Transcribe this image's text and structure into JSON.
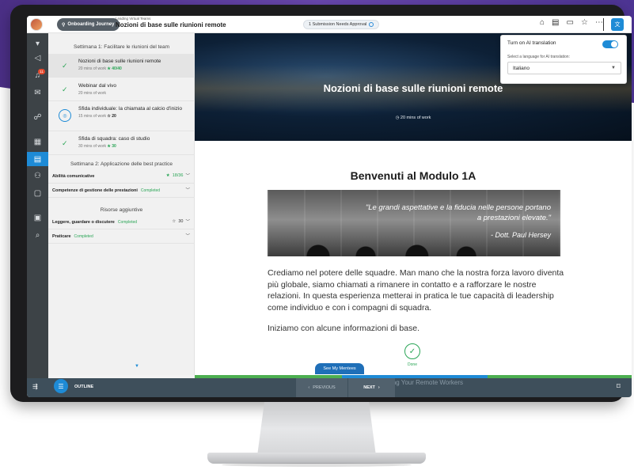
{
  "topbar": {
    "course_pill": "Onboarding Journey",
    "crumb_small": "Leading Virtual Teams",
    "crumb_title": "Nozioni di base sulle riunioni remote",
    "approval": "1 Submission Needs Approval"
  },
  "popup": {
    "title": "Turn on AI translation",
    "label": "Select a language for AI translation:",
    "selected": "Italiano",
    "enabled": true
  },
  "outline": {
    "section1": "Settimana 1: Facilitare le riunioni del team",
    "lessons": [
      {
        "title": "Nozioni di base sulle riunioni remote",
        "meta": "20 mins of work",
        "pts": "40/40",
        "status": "done"
      },
      {
        "title": "Webinar dal vivo",
        "meta": "20 mins of work",
        "pts": "",
        "status": "done"
      },
      {
        "title": "Sfida individuale: la chiamata al calcio d'inizio",
        "meta": "15 mins of work",
        "pts": "20",
        "status": "pending"
      },
      {
        "title": "Sfida di squadra: caso di studio",
        "meta": "30 mins of work",
        "pts": "30",
        "status": "done"
      }
    ],
    "section2": "Settimana 2: Applicazione delle best practice",
    "group1": {
      "title": "Abilità comunicative",
      "score": "18/36"
    },
    "group2": {
      "title": "Competenze di gestione delle prestazioni",
      "status": "Completed"
    },
    "section3": "Risorse aggiuntive",
    "group3": {
      "title": "Leggere, guardare o discutere",
      "status": "Completed",
      "score": "30"
    },
    "group4": {
      "title": "Praticare",
      "status": "Completed"
    }
  },
  "hero": {
    "title": "Nozioni di base sulle riunioni remote",
    "subtitle": "20 mins of work"
  },
  "content": {
    "module_title": "Benvenuti al Modulo 1A",
    "quote": "\"Le grandi aspettative e la fiducia nelle persone portano a prestazioni elevate.\"",
    "quote_author": "- Dott. Paul Hersey",
    "paragraph1": "Crediamo nel potere delle squadre. Man mano che la nostra forza lavoro diventa più globale, siamo chiamati a rimanere in contatto e a rafforzare le nostre relazioni. In questa esperienza metterai in pratica le tue capacità di leadership come individuo e con i compagni di squadra.",
    "paragraph2": "Iniziamo con alcune informazioni di base.",
    "done_label": "Done",
    "ghost": "ing Your Remote Workers"
  },
  "bottombar": {
    "outline": "OUTLINE",
    "previous": "PREVIOUS",
    "next": "NEXT",
    "mentees": "See My Mentees"
  },
  "colors": {
    "accent": "#1e8bd6",
    "success": "#2aa556",
    "sidebar": "#3d4347",
    "bottombar": "#3e4f5b",
    "progress_blue": "#1e8bd6",
    "progress_green": "#4caf50"
  }
}
